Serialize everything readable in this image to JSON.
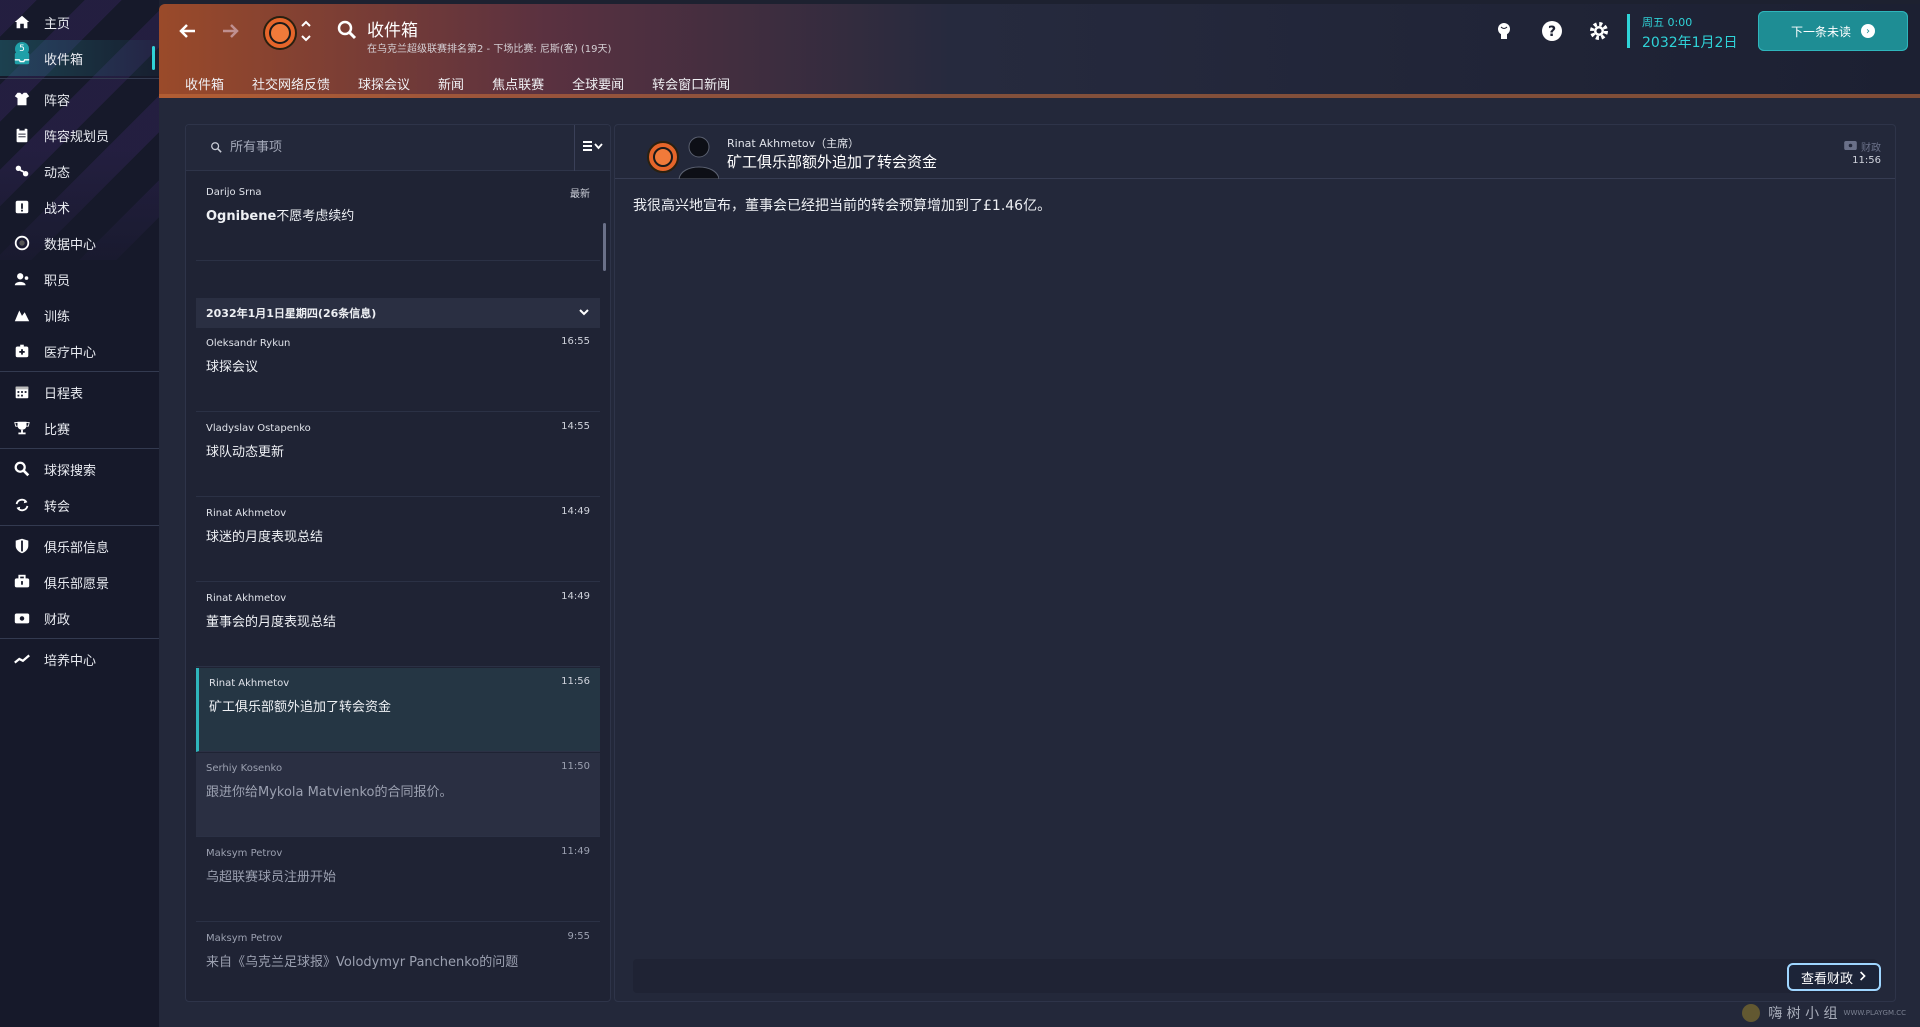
{
  "sidebar": {
    "items": [
      {
        "label": "主页",
        "icon": "home-icon"
      },
      {
        "label": "收件箱",
        "icon": "inbox-icon",
        "badge": "5",
        "active": true
      },
      {
        "label": "阵容",
        "icon": "squad-icon"
      },
      {
        "label": "阵容规划员",
        "icon": "clipboard-icon"
      },
      {
        "label": "动态",
        "icon": "dynamics-icon"
      },
      {
        "label": "战术",
        "icon": "tactics-icon"
      },
      {
        "label": "数据中心",
        "icon": "data-hub-icon"
      },
      {
        "label": "职员",
        "icon": "staff-icon"
      },
      {
        "label": "训练",
        "icon": "training-icon"
      },
      {
        "label": "医疗中心",
        "icon": "medical-icon"
      },
      {
        "label": "日程表",
        "icon": "calendar-icon"
      },
      {
        "label": "比赛",
        "icon": "trophy-icon"
      },
      {
        "label": "球探搜索",
        "icon": "scout-search-icon"
      },
      {
        "label": "转会",
        "icon": "transfer-icon"
      },
      {
        "label": "俱乐部信息",
        "icon": "shield-icon"
      },
      {
        "label": "俱乐部愿景",
        "icon": "vision-icon"
      },
      {
        "label": "财政",
        "icon": "finance-icon"
      },
      {
        "label": "培养中心",
        "icon": "development-icon"
      }
    ]
  },
  "header": {
    "title": "收件箱",
    "subtitle": "在乌克兰超级联赛排名第2 - 下场比赛: 尼斯(客) (19天)",
    "tabs": [
      "收件箱",
      "社交网络反馈",
      "球探会议",
      "新闻",
      "焦点联赛",
      "全球要闻",
      "转会窗口新闻"
    ],
    "day": "周五 0:00",
    "date": "2032年1月2日",
    "next_label": "下一条未读",
    "next_icon": "›"
  },
  "list": {
    "search_placeholder": "所有事项",
    "top_message": {
      "from": "Darijo Srna",
      "time": "最新",
      "subject_bold": "Ognibene",
      "subject_rest": "不愿考虑续约"
    },
    "group_label": "2032年1月1日星期四(26条信息)",
    "messages": [
      {
        "from": "Oleksandr Rykun",
        "time": "16:55",
        "subject": "球探会议"
      },
      {
        "from": "Vladyslav Ostapenko",
        "time": "14:55",
        "subject": "球队动态更新"
      },
      {
        "from": "Rinat Akhmetov",
        "time": "14:49",
        "subject": "球迷的月度表现总结"
      },
      {
        "from": "Rinat Akhmetov",
        "time": "14:49",
        "subject": "董事会的月度表现总结"
      },
      {
        "from": "Rinat Akhmetov",
        "time": "11:56",
        "subject": "矿工俱乐部额外追加了转会资金"
      },
      {
        "from": "Serhiy Kosenko",
        "time": "11:50",
        "subject": "跟进你给Mykola Matvienko的合同报价。"
      },
      {
        "from": "Maksym Petrov",
        "time": "11:49",
        "subject": "乌超联赛球员注册开始"
      },
      {
        "from": "Maksym Petrov",
        "time": "9:55",
        "subject": "来自《乌克兰足球报》Volodymyr Panchenko的问题"
      }
    ]
  },
  "detail": {
    "sender": "Rinat Akhmetov（主席）",
    "subject": "矿工俱乐部额外追加了转会资金",
    "tag": "财政",
    "time": "11:56",
    "body": "我很高兴地宣布，董事会已经把当前的转会预算增加到了£1.46亿。",
    "finance_button": "查看财政"
  },
  "watermark": {
    "text": "嗨 树 小 组",
    "sub": "WWW.PLAYGM.CC"
  },
  "colors": {
    "accent": "#2fd3d8",
    "next_button": "#1e8d94",
    "club_orange": "#e5652a"
  }
}
